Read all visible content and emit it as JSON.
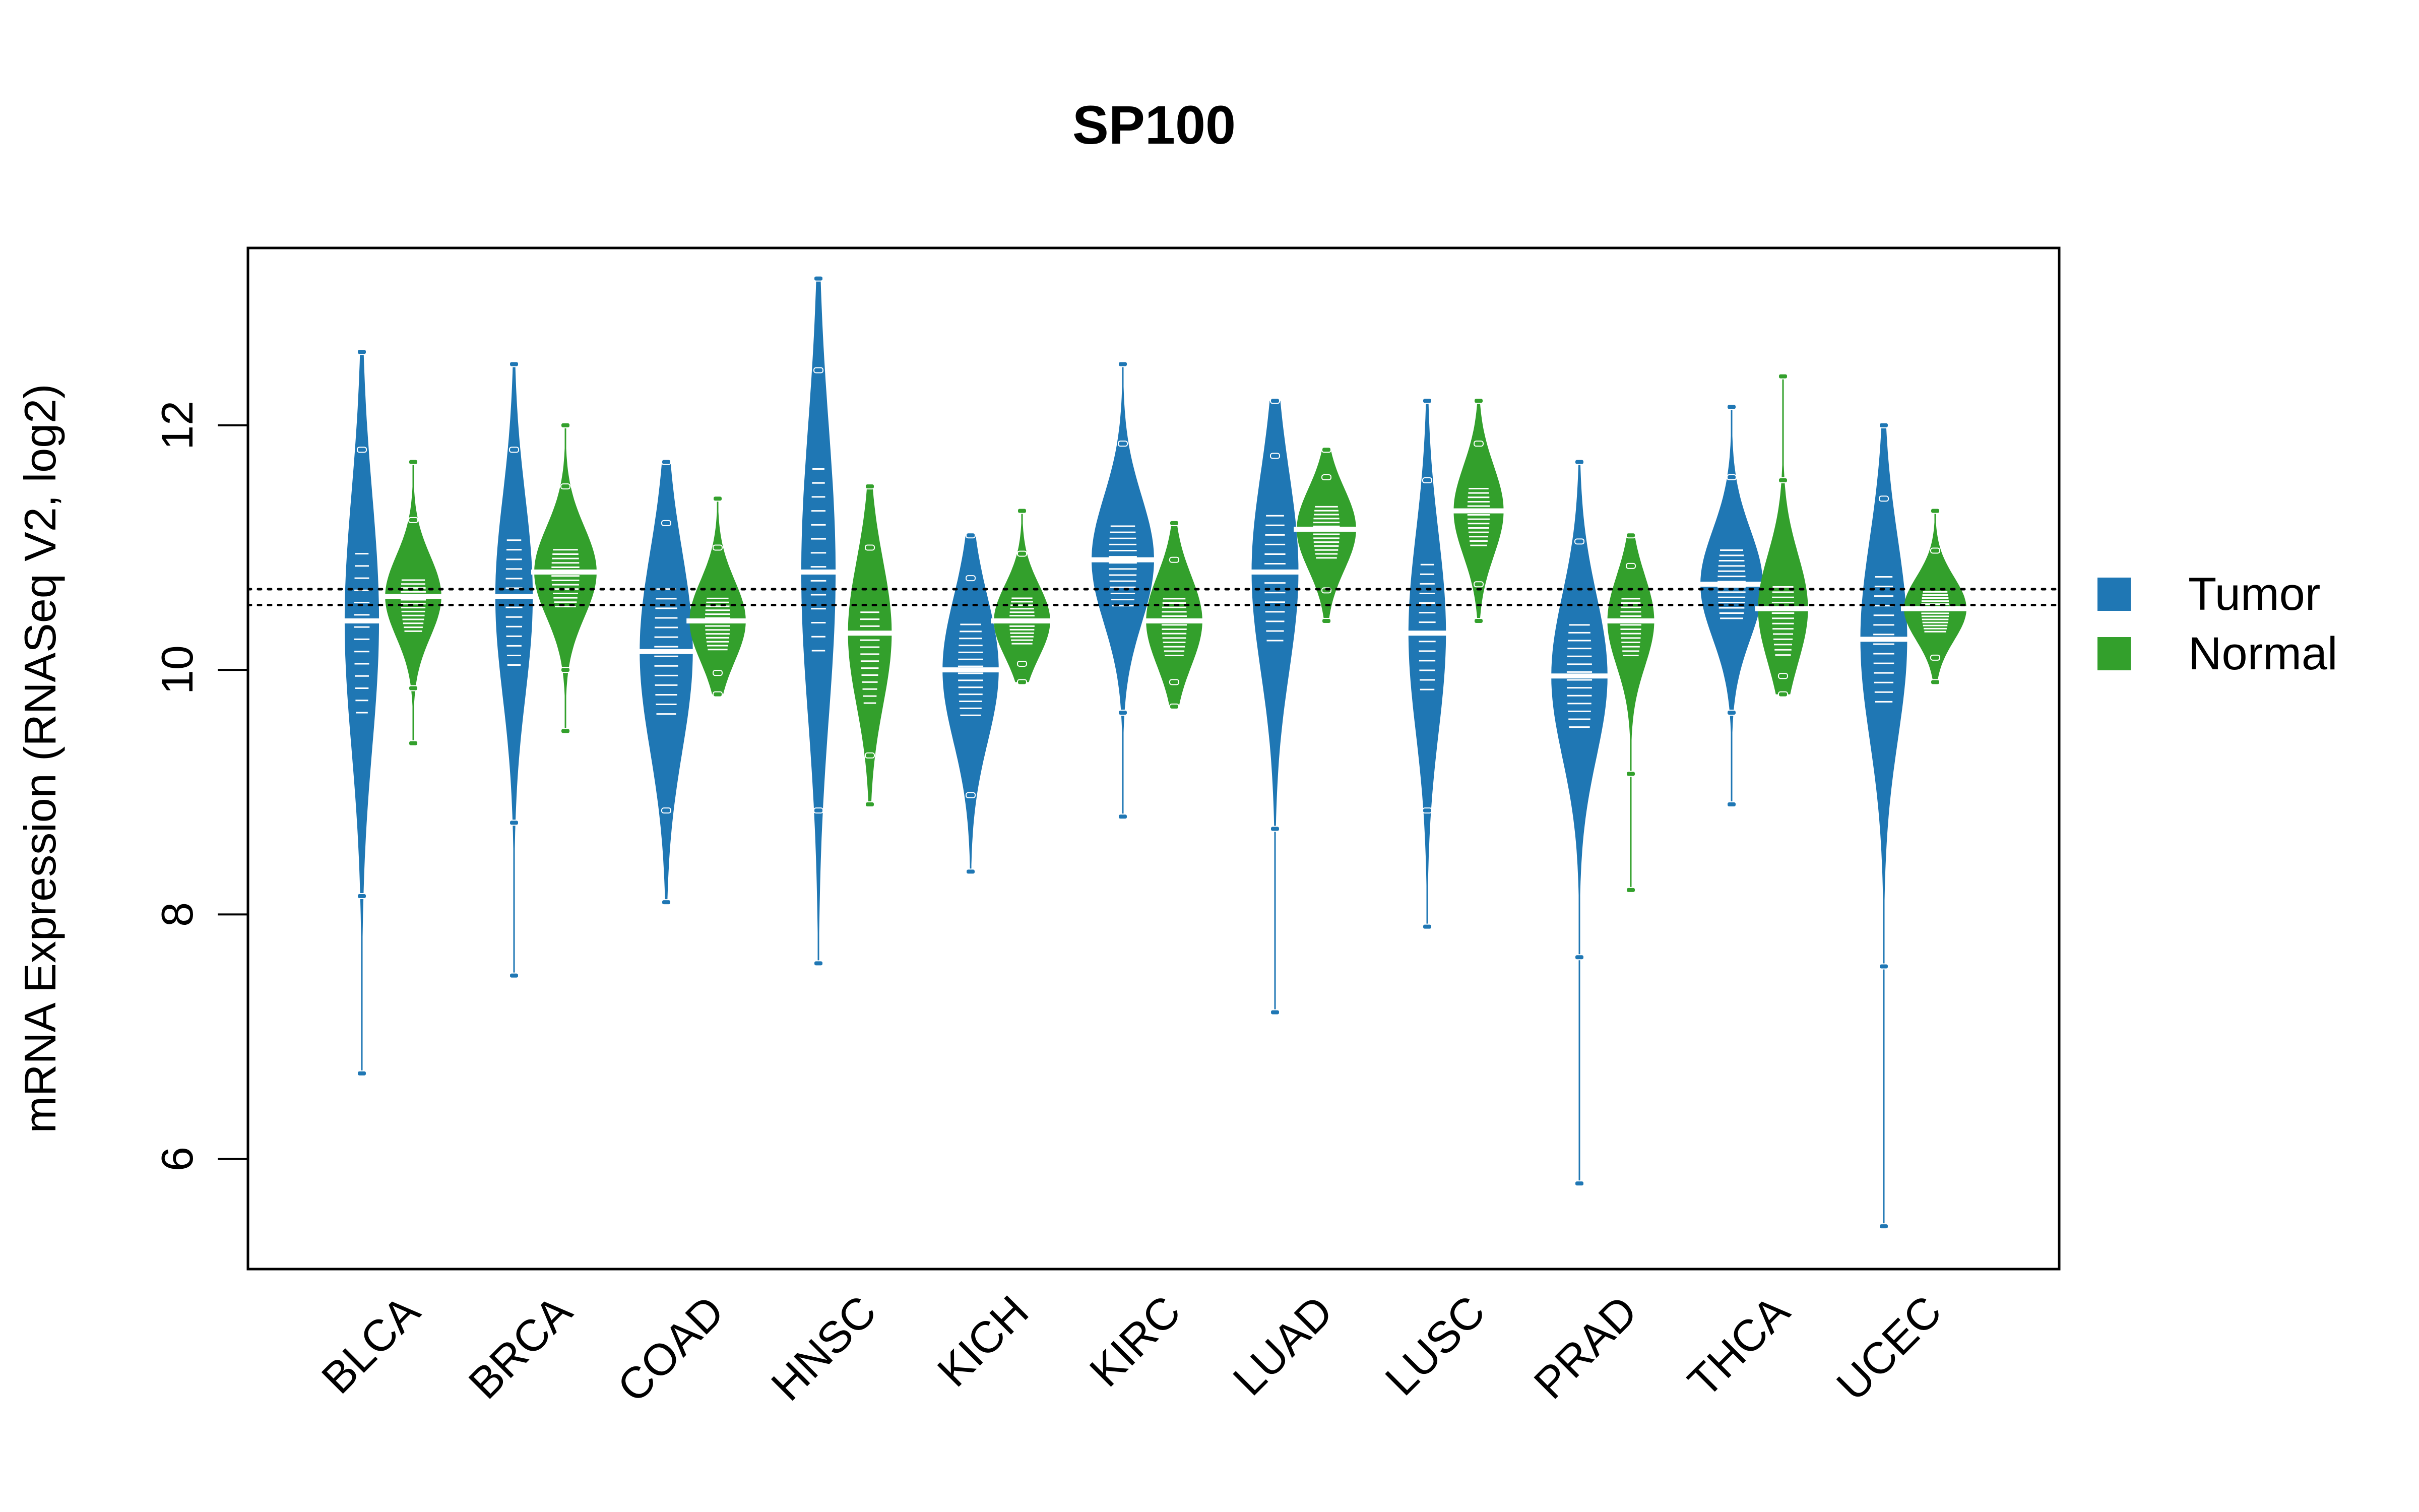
{
  "chart_data": {
    "type": "violin",
    "title": "SP100",
    "xlabel": "",
    "ylabel": "mRNA Expression (RNASeq V2, log2)",
    "ylim": [
      5.1,
      13.45
    ],
    "yticks": [
      6,
      8,
      10,
      12
    ],
    "grid": false,
    "categories": [
      "BLCA",
      "BRCA",
      "COAD",
      "HNSC",
      "KICH",
      "KIRC",
      "LUAD",
      "LUSC",
      "PRAD",
      "THCA",
      "UCEC"
    ],
    "reference_lines": [
      10.66,
      10.53
    ],
    "legend": {
      "position": "right",
      "entries": [
        {
          "name": "Tumor",
          "color": "#1f77b4"
        },
        {
          "name": "Normal",
          "color": "#33a02c"
        }
      ]
    },
    "series": [
      {
        "name": "Tumor",
        "color": "#1f77b4",
        "groups": [
          {
            "category": "BLCA",
            "min": 6.7,
            "q1": 9.6,
            "median": 10.4,
            "q3": 11.0,
            "max": 12.6,
            "spread": 0.55
          },
          {
            "category": "BRCA",
            "min": 7.5,
            "q1": 10.0,
            "median": 10.6,
            "q3": 11.1,
            "max": 12.5,
            "spread": 0.6
          },
          {
            "category": "COAD",
            "min": 8.1,
            "q1": 9.6,
            "median": 10.15,
            "q3": 10.7,
            "max": 11.7,
            "spread": 0.85
          },
          {
            "category": "HNSC",
            "min": 7.6,
            "q1": 10.1,
            "median": 10.8,
            "q3": 11.7,
            "max": 13.2,
            "spread": 0.55
          },
          {
            "category": "KICH",
            "min": 8.35,
            "q1": 9.6,
            "median": 10.0,
            "q3": 10.4,
            "max": 11.1,
            "spread": 0.9
          },
          {
            "category": "KIRC",
            "min": 8.8,
            "q1": 10.5,
            "median": 10.9,
            "q3": 11.2,
            "max": 12.5,
            "spread": 1.0
          },
          {
            "category": "LUAD",
            "min": 7.2,
            "q1": 10.2,
            "median": 10.8,
            "q3": 11.3,
            "max": 12.2,
            "spread": 0.75
          },
          {
            "category": "LUSC",
            "min": 7.9,
            "q1": 9.8,
            "median": 10.3,
            "q3": 10.9,
            "max": 12.2,
            "spread": 0.6
          },
          {
            "category": "PRAD",
            "min": 5.8,
            "q1": 9.5,
            "median": 9.95,
            "q3": 10.4,
            "max": 11.7,
            "spread": 0.9
          },
          {
            "category": "THCA",
            "min": 8.9,
            "q1": 10.4,
            "median": 10.7,
            "q3": 11.0,
            "max": 12.15,
            "spread": 1.0
          },
          {
            "category": "UCEC",
            "min": 5.45,
            "q1": 9.7,
            "median": 10.25,
            "q3": 10.8,
            "max": 12.0,
            "spread": 0.75
          }
        ]
      },
      {
        "name": "Normal",
        "color": "#33a02c",
        "groups": [
          {
            "category": "BLCA",
            "min": 9.4,
            "q1": 10.3,
            "median": 10.6,
            "q3": 10.75,
            "max": 11.7,
            "spread": 0.9
          },
          {
            "category": "BRCA",
            "min": 9.5,
            "q1": 10.5,
            "median": 10.8,
            "q3": 11.0,
            "max": 12.0,
            "spread": 1.0
          },
          {
            "category": "COAD",
            "min": 9.8,
            "q1": 10.15,
            "median": 10.4,
            "q3": 10.6,
            "max": 11.4,
            "spread": 0.9
          },
          {
            "category": "HNSC",
            "min": 8.9,
            "q1": 9.7,
            "median": 10.3,
            "q3": 10.5,
            "max": 11.5,
            "spread": 0.7
          },
          {
            "category": "KICH",
            "min": 9.9,
            "q1": 10.2,
            "median": 10.4,
            "q3": 10.6,
            "max": 11.3,
            "spread": 0.9
          },
          {
            "category": "KIRC",
            "min": 9.7,
            "q1": 10.1,
            "median": 10.4,
            "q3": 10.6,
            "max": 11.2,
            "spread": 0.9
          },
          {
            "category": "LUAD",
            "min": 10.4,
            "q1": 10.9,
            "median": 11.15,
            "q3": 11.35,
            "max": 11.8,
            "spread": 0.95
          },
          {
            "category": "LUSC",
            "min": 10.4,
            "q1": 11.0,
            "median": 11.3,
            "q3": 11.5,
            "max": 12.2,
            "spread": 0.8
          },
          {
            "category": "PRAD",
            "min": 8.2,
            "q1": 10.1,
            "median": 10.4,
            "q3": 10.6,
            "max": 11.1,
            "spread": 0.75
          },
          {
            "category": "THCA",
            "min": 9.8,
            "q1": 10.1,
            "median": 10.5,
            "q3": 10.7,
            "max": 12.4,
            "spread": 0.8
          },
          {
            "category": "UCEC",
            "min": 9.9,
            "q1": 10.3,
            "median": 10.5,
            "q3": 10.65,
            "max": 11.3,
            "spread": 1.0
          }
        ]
      }
    ]
  }
}
